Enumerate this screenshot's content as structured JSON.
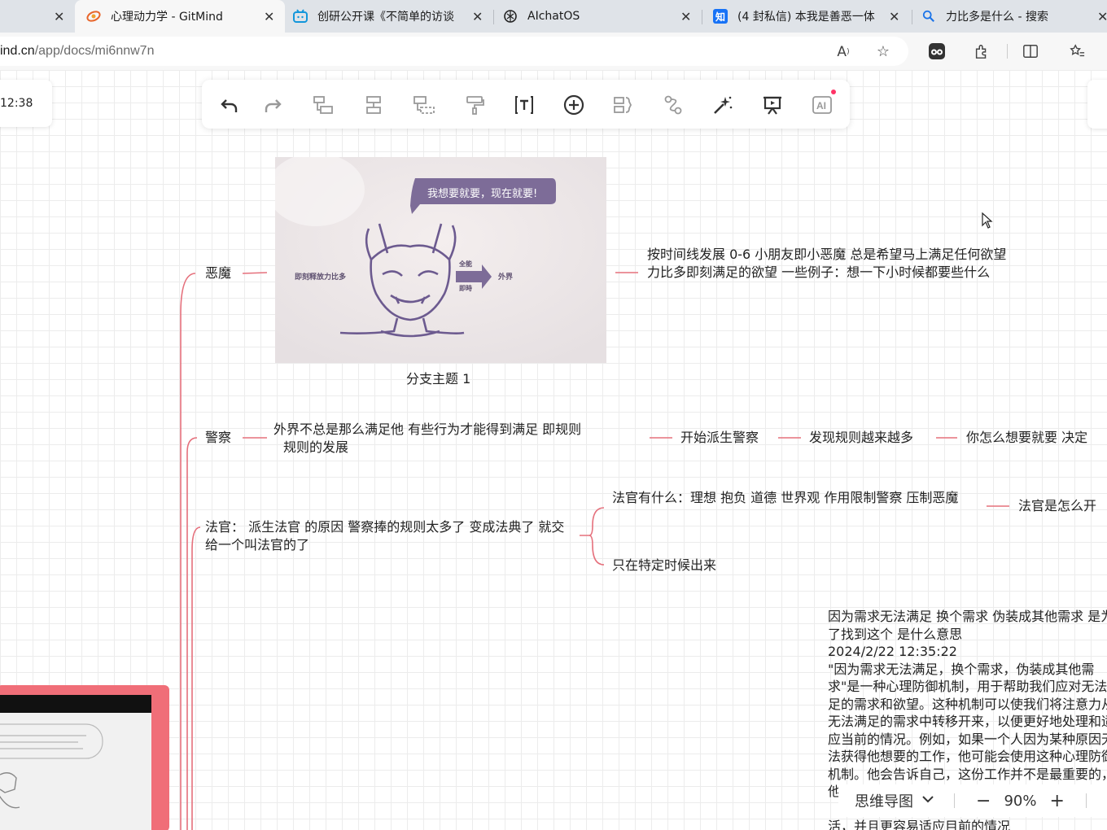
{
  "tabs": [
    {
      "title": "心理动力学 - GitMind",
      "active": true,
      "icon": "gitmind-icon"
    },
    {
      "title": "创研公开课《不简单的访谈",
      "active": false,
      "icon": "bilibili-icon"
    },
    {
      "title": "AIchatOS",
      "active": false,
      "icon": "openai-icon"
    },
    {
      "title": "(4 封私信) 本我是善恶一体",
      "active": false,
      "icon": "zhihu-icon"
    },
    {
      "title": "力比多是什么 - 搜索",
      "active": false,
      "icon": "search-icon"
    }
  ],
  "address": {
    "host": "ind.cn",
    "path": "/app/docs/mi6nnw7n"
  },
  "time_label": "12:38",
  "toolbar": {
    "tools": [
      "undo",
      "redo",
      "insert-child",
      "insert-sibling",
      "insert-parent",
      "format-painter",
      "text",
      "add",
      "summary",
      "relation",
      "style",
      "presentation",
      "ai"
    ]
  },
  "image_node": {
    "caption": "分支主题 1",
    "bubble": "我想要就要，现在就要!",
    "left_label": "即刻释放力比多",
    "arrow_top": "全能",
    "arrow_bottom": "即時",
    "right_label": "外界"
  },
  "nodes": {
    "demon": "恶魔",
    "demon_desc": "按时间线发展 0-6  小朋友即小恶魔 总是希望马上满足任何欲望  力比多即刻满足的欲望   一些例子：想一下小时候都要些什么",
    "police": "警察",
    "police_desc_line1": "外界不总是那么满足他  有些行为才能得到满足  即规则",
    "police_desc_line2": "规则的发展",
    "police_step1": "开始派生警察",
    "police_step2": "发现规则越来越多",
    "police_step3": "你怎么想要就要  决定",
    "judge": "法官：  派生法官 的原因   警察捧的规则太多了    变成法典了 就交给一个叫法官的了",
    "judge_child1": "法官有什么：理想 抱负 道德 世界观     作用限制警察  压制恶魔",
    "judge_child1_next": "法官是怎么开",
    "judge_child2": "只在特定时候出来"
  },
  "note": {
    "question": "因为需求无法满足 换个需求 伪装成其他需求 是为了找到这个 是什么意思",
    "timestamp": "2024/2/22 12:35:22",
    "answer": "\"因为需求无法满足，换个需求，伪装成其他需求\"是一种心理防御机制，用于帮助我们应对无法满足的需求和欲望。这种机制可以使我们将注意力从无法满足的需求中转移开来，以便更好地处理和适应当前的情况。例如，如果一个人因为某种原因无法获得他想要的工作，他可能会使用这种心理防御机制。他会告诉自己，这份工作并不是最重要的，他需要关注其他方面",
    "tail": "活，并且更容易适应目前的情况"
  },
  "bottom": {
    "view_mode": "思维导图",
    "zoom": "90%"
  },
  "colors": {
    "branch": "#e5707c",
    "tabbar": "#dfe3e8"
  }
}
